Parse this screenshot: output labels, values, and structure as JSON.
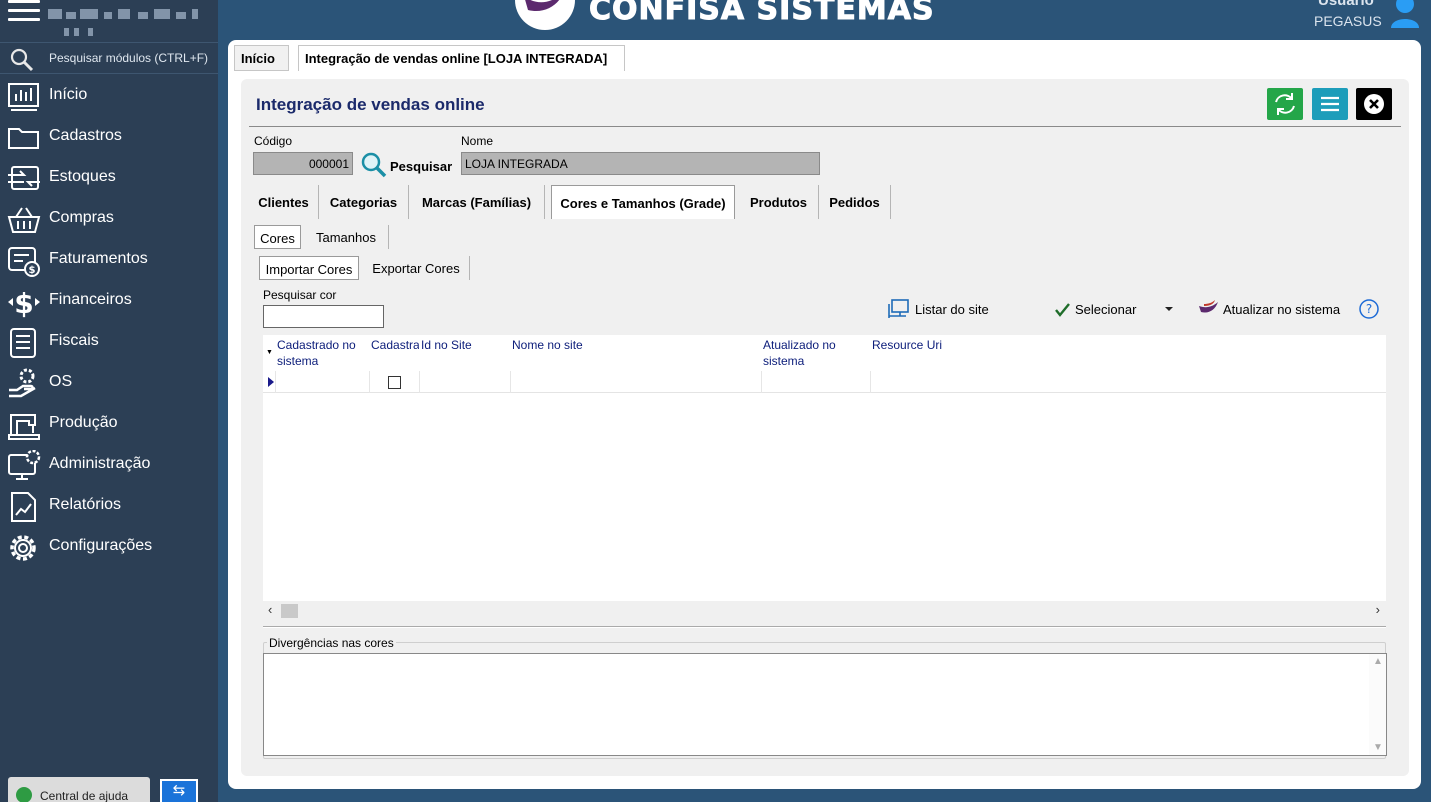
{
  "header": {
    "brand": "CONFISA SISTEMAS",
    "user_label": "Usuário",
    "user_name": "PEGASUS"
  },
  "sidebar": {
    "search_placeholder": "Pesquisar módulos (CTRL+F)",
    "items": [
      {
        "label": "Início",
        "icon": "chart-icon"
      },
      {
        "label": "Cadastros",
        "icon": "folder-icon"
      },
      {
        "label": "Estoques",
        "icon": "exchange-icon"
      },
      {
        "label": "Compras",
        "icon": "basket-icon"
      },
      {
        "label": "Faturamentos",
        "icon": "invoice-icon"
      },
      {
        "label": "Financeiros",
        "icon": "dollar-icon"
      },
      {
        "label": "Fiscais",
        "icon": "list-icon"
      },
      {
        "label": "OS",
        "icon": "service-hand-icon"
      },
      {
        "label": "Produção",
        "icon": "sewing-machine-icon"
      },
      {
        "label": "Administração",
        "icon": "monitor-gear-icon"
      },
      {
        "label": "Relatórios",
        "icon": "report-icon"
      },
      {
        "label": "Configurações",
        "icon": "gear-icon"
      }
    ],
    "help_label": "Central de ajuda",
    "toggle_label": "⇆"
  },
  "page_tabs": [
    "Início",
    "Integração de vendas online [LOJA INTEGRADA]"
  ],
  "form": {
    "title": "Integração de vendas online",
    "codigo_label": "Código",
    "codigo_value": "000001",
    "search_label": "Pesquisar",
    "nome_label": "Nome",
    "nome_value": "LOJA INTEGRADA",
    "tabs": [
      "Clientes",
      "Categorias",
      "Marcas (Famílias)",
      "Cores e Tamanhos (Grade)",
      "Produtos",
      "Pedidos"
    ],
    "active_tab": "Cores e Tamanhos (Grade)",
    "sub_tabs": [
      "Cores",
      "Tamanhos"
    ],
    "sub_tabs2": [
      "Importar Cores",
      "Exportar Cores"
    ],
    "pesquisar_cor_label": "Pesquisar cor",
    "pesquisar_cor_value": "",
    "toolbar": {
      "listar": "Listar do site",
      "selecionar": "Selecionar",
      "atualizar": "Atualizar no sistema",
      "help": "?"
    },
    "grid": {
      "columns": [
        "Cadastrado no sistema",
        "Cadastra",
        "Id no Site",
        "Nome no site",
        "Atualizado no sistema",
        "Resource Uri"
      ],
      "rows": [
        {
          "cadastrado": "",
          "checked": false,
          "id": "",
          "nome": "",
          "atualizado": "",
          "uri": ""
        }
      ]
    },
    "divergencias_label": "Divergências nas cores",
    "divergencias_value": ""
  },
  "colors": {
    "sidebar_bg": "#2c3f55",
    "header_bg": "#2b5478",
    "refresh_btn": "#24a649",
    "menu_btn": "#1d9dba",
    "close_btn": "#000000",
    "title_color": "#1b2a6b"
  }
}
